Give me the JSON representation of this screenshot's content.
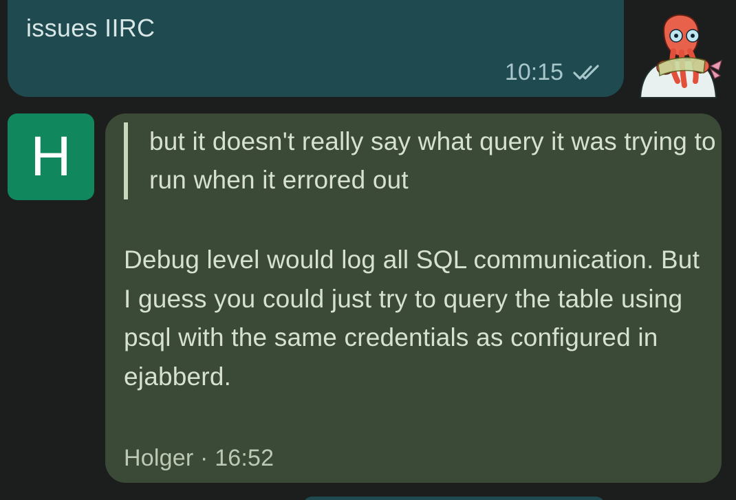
{
  "outgoing_message": {
    "text": "issues IIRC",
    "time": "10:15",
    "status_icon": "double-check-icon",
    "colors": {
      "bubble": "#1f4a50",
      "text": "#d8e6e6"
    }
  },
  "self_avatar": {
    "icon": "cartoon-avatar-image"
  },
  "incoming_message": {
    "avatar_letter": "H",
    "avatar_color": "#11875d",
    "quote": "but it doesn't really say what query it was trying to run when it errored out",
    "body": "Debug level would log all SQL communication. But I guess you could just try to query the table using psql with the same credentials as configured in ejabberd.",
    "sender": "Holger",
    "separator": " · ",
    "time": "16:52",
    "colors": {
      "bubble": "#3b4a36",
      "text": "#d6e2cf"
    }
  }
}
